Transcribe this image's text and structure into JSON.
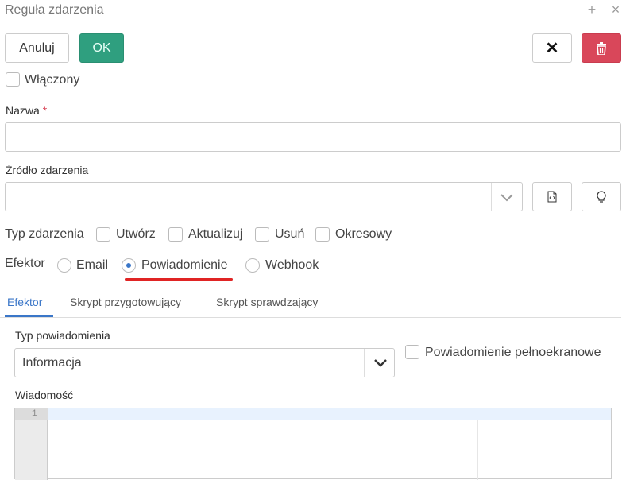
{
  "window": {
    "title": "Reguła zdarzenia",
    "plus_glyph": "+",
    "close_glyph": "×"
  },
  "toolbar": {
    "cancel_label": "Anuluj",
    "ok_label": "OK",
    "clear_glyph": "✕"
  },
  "enabled_label": "Włączony",
  "name": {
    "label": "Nazwa",
    "required_mark": "*",
    "value": ""
  },
  "source": {
    "label": "Źródło zdarzenia",
    "value": ""
  },
  "event_type": {
    "label": "Typ zdarzenia",
    "options": [
      "Utwórz",
      "Aktualizuj",
      "Usuń",
      "Okresowy"
    ]
  },
  "effector": {
    "label": "Efektor",
    "options": [
      "Email",
      "Powiadomienie",
      "Webhook"
    ],
    "selected": "Powiadomienie"
  },
  "tabs": [
    "Efektor",
    "Skrypt przygotowujący",
    "Skrypt sprawdzający"
  ],
  "notification": {
    "type_label": "Typ powiadomienia",
    "type_value": "Informacja",
    "fullscreen_label": "Powiadomienie pełnoekranowe",
    "message_label": "Wiadomość",
    "line_number": "1"
  },
  "colors": {
    "ok": "#2f9f7f",
    "delete": "#d9475a",
    "accent": "#3a76c8",
    "underline": "#e02424"
  }
}
